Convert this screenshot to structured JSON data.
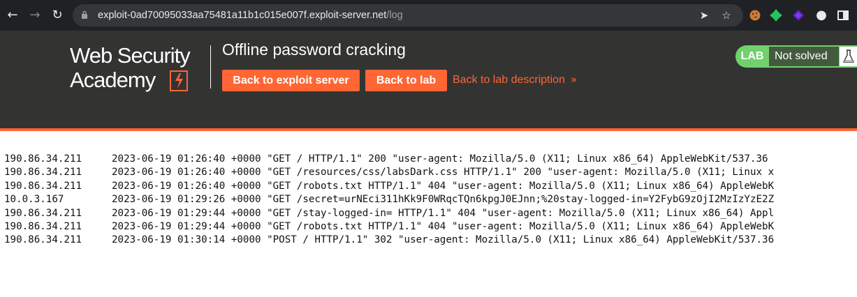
{
  "browser": {
    "url_host": "exploit-0ad70095033aa75481a11b1c015e007f.exploit-server.net",
    "url_path": "/log",
    "icons": [
      "back-arrow-icon",
      "forward-arrow-icon",
      "reload-icon",
      "lock-icon",
      "send-icon",
      "star-icon",
      "cookie-extension-icon",
      "green-extension-icon",
      "purple-extension-icon",
      "puzzle-icon",
      "sidepanel-icon"
    ]
  },
  "header": {
    "logo_line1": "Web Security",
    "logo_line2": "Academy",
    "lab_title": "Offline password cracking",
    "buttons": {
      "back_to_exploit": "Back to exploit server",
      "back_to_lab": "Back to lab",
      "back_to_description": "Back to lab description"
    },
    "status": {
      "tag": "LAB",
      "text": "Not solved"
    },
    "colors": {
      "accent": "#ff6633",
      "header_bg": "#333332",
      "status_green": "#70d16d"
    }
  },
  "log": {
    "entries": [
      {
        "ip": "190.86.34.211",
        "text": "2023-06-19 01:26:40 +0000 \"GET / HTTP/1.1\" 200 \"user-agent: Mozilla/5.0 (X11; Linux x86_64) AppleWebKit/537.36"
      },
      {
        "ip": "190.86.34.211",
        "text": "2023-06-19 01:26:40 +0000 \"GET /resources/css/labsDark.css HTTP/1.1\" 200 \"user-agent: Mozilla/5.0 (X11; Linux x"
      },
      {
        "ip": "190.86.34.211",
        "text": "2023-06-19 01:26:40 +0000 \"GET /robots.txt HTTP/1.1\" 404 \"user-agent: Mozilla/5.0 (X11; Linux x86_64) AppleWebK"
      },
      {
        "ip": "10.0.3.167",
        "text": "2023-06-19 01:29:26 +0000 \"GET /secret=urNEci311hKk9F0WRqcTQn6kpgJ0EJnn;%20stay-logged-in=Y2FybG9zOjI2MzIzYzE2Z"
      },
      {
        "ip": "190.86.34.211",
        "text": "2023-06-19 01:29:44 +0000 \"GET /stay-logged-in= HTTP/1.1\" 404 \"user-agent: Mozilla/5.0 (X11; Linux x86_64) Appl"
      },
      {
        "ip": "190.86.34.211",
        "text": "2023-06-19 01:29:44 +0000 \"GET /robots.txt HTTP/1.1\" 404 \"user-agent: Mozilla/5.0 (X11; Linux x86_64) AppleWebK"
      },
      {
        "ip": "190.86.34.211",
        "text": "2023-06-19 01:30:14 +0000 \"POST / HTTP/1.1\" 302 \"user-agent: Mozilla/5.0 (X11; Linux x86_64) AppleWebKit/537.36"
      }
    ]
  }
}
